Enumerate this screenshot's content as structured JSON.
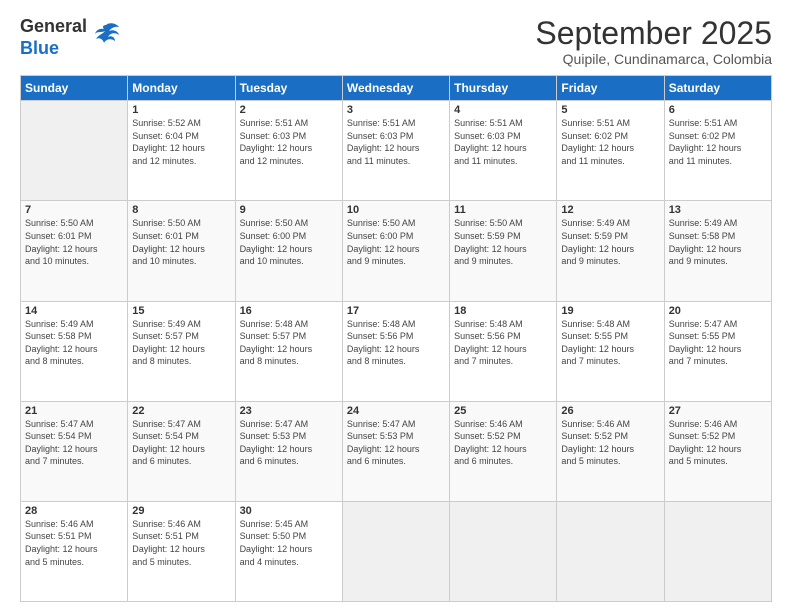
{
  "logo": {
    "general": "General",
    "blue": "Blue",
    "tagline": "GeneralBlue"
  },
  "header": {
    "month_year": "September 2025",
    "location": "Quipile, Cundinamarca, Colombia"
  },
  "weekdays": [
    "Sunday",
    "Monday",
    "Tuesday",
    "Wednesday",
    "Thursday",
    "Friday",
    "Saturday"
  ],
  "weeks": [
    [
      {
        "day": "",
        "sunrise": "",
        "sunset": "",
        "daylight": ""
      },
      {
        "day": "1",
        "sunrise": "Sunrise: 5:52 AM",
        "sunset": "Sunset: 6:04 PM",
        "daylight": "Daylight: 12 hours and 12 minutes."
      },
      {
        "day": "2",
        "sunrise": "Sunrise: 5:51 AM",
        "sunset": "Sunset: 6:03 PM",
        "daylight": "Daylight: 12 hours and 12 minutes."
      },
      {
        "day": "3",
        "sunrise": "Sunrise: 5:51 AM",
        "sunset": "Sunset: 6:03 PM",
        "daylight": "Daylight: 12 hours and 11 minutes."
      },
      {
        "day": "4",
        "sunrise": "Sunrise: 5:51 AM",
        "sunset": "Sunset: 6:03 PM",
        "daylight": "Daylight: 12 hours and 11 minutes."
      },
      {
        "day": "5",
        "sunrise": "Sunrise: 5:51 AM",
        "sunset": "Sunset: 6:02 PM",
        "daylight": "Daylight: 12 hours and 11 minutes."
      },
      {
        "day": "6",
        "sunrise": "Sunrise: 5:51 AM",
        "sunset": "Sunset: 6:02 PM",
        "daylight": "Daylight: 12 hours and 11 minutes."
      }
    ],
    [
      {
        "day": "7",
        "sunrise": "Sunrise: 5:50 AM",
        "sunset": "Sunset: 6:01 PM",
        "daylight": "Daylight: 12 hours and 10 minutes."
      },
      {
        "day": "8",
        "sunrise": "Sunrise: 5:50 AM",
        "sunset": "Sunset: 6:01 PM",
        "daylight": "Daylight: 12 hours and 10 minutes."
      },
      {
        "day": "9",
        "sunrise": "Sunrise: 5:50 AM",
        "sunset": "Sunset: 6:00 PM",
        "daylight": "Daylight: 12 hours and 10 minutes."
      },
      {
        "day": "10",
        "sunrise": "Sunrise: 5:50 AM",
        "sunset": "Sunset: 6:00 PM",
        "daylight": "Daylight: 12 hours and 9 minutes."
      },
      {
        "day": "11",
        "sunrise": "Sunrise: 5:50 AM",
        "sunset": "Sunset: 5:59 PM",
        "daylight": "Daylight: 12 hours and 9 minutes."
      },
      {
        "day": "12",
        "sunrise": "Sunrise: 5:49 AM",
        "sunset": "Sunset: 5:59 PM",
        "daylight": "Daylight: 12 hours and 9 minutes."
      },
      {
        "day": "13",
        "sunrise": "Sunrise: 5:49 AM",
        "sunset": "Sunset: 5:58 PM",
        "daylight": "Daylight: 12 hours and 9 minutes."
      }
    ],
    [
      {
        "day": "14",
        "sunrise": "Sunrise: 5:49 AM",
        "sunset": "Sunset: 5:58 PM",
        "daylight": "Daylight: 12 hours and 8 minutes."
      },
      {
        "day": "15",
        "sunrise": "Sunrise: 5:49 AM",
        "sunset": "Sunset: 5:57 PM",
        "daylight": "Daylight: 12 hours and 8 minutes."
      },
      {
        "day": "16",
        "sunrise": "Sunrise: 5:48 AM",
        "sunset": "Sunset: 5:57 PM",
        "daylight": "Daylight: 12 hours and 8 minutes."
      },
      {
        "day": "17",
        "sunrise": "Sunrise: 5:48 AM",
        "sunset": "Sunset: 5:56 PM",
        "daylight": "Daylight: 12 hours and 8 minutes."
      },
      {
        "day": "18",
        "sunrise": "Sunrise: 5:48 AM",
        "sunset": "Sunset: 5:56 PM",
        "daylight": "Daylight: 12 hours and 7 minutes."
      },
      {
        "day": "19",
        "sunrise": "Sunrise: 5:48 AM",
        "sunset": "Sunset: 5:55 PM",
        "daylight": "Daylight: 12 hours and 7 minutes."
      },
      {
        "day": "20",
        "sunrise": "Sunrise: 5:47 AM",
        "sunset": "Sunset: 5:55 PM",
        "daylight": "Daylight: 12 hours and 7 minutes."
      }
    ],
    [
      {
        "day": "21",
        "sunrise": "Sunrise: 5:47 AM",
        "sunset": "Sunset: 5:54 PM",
        "daylight": "Daylight: 12 hours and 7 minutes."
      },
      {
        "day": "22",
        "sunrise": "Sunrise: 5:47 AM",
        "sunset": "Sunset: 5:54 PM",
        "daylight": "Daylight: 12 hours and 6 minutes."
      },
      {
        "day": "23",
        "sunrise": "Sunrise: 5:47 AM",
        "sunset": "Sunset: 5:53 PM",
        "daylight": "Daylight: 12 hours and 6 minutes."
      },
      {
        "day": "24",
        "sunrise": "Sunrise: 5:47 AM",
        "sunset": "Sunset: 5:53 PM",
        "daylight": "Daylight: 12 hours and 6 minutes."
      },
      {
        "day": "25",
        "sunrise": "Sunrise: 5:46 AM",
        "sunset": "Sunset: 5:52 PM",
        "daylight": "Daylight: 12 hours and 6 minutes."
      },
      {
        "day": "26",
        "sunrise": "Sunrise: 5:46 AM",
        "sunset": "Sunset: 5:52 PM",
        "daylight": "Daylight: 12 hours and 5 minutes."
      },
      {
        "day": "27",
        "sunrise": "Sunrise: 5:46 AM",
        "sunset": "Sunset: 5:52 PM",
        "daylight": "Daylight: 12 hours and 5 minutes."
      }
    ],
    [
      {
        "day": "28",
        "sunrise": "Sunrise: 5:46 AM",
        "sunset": "Sunset: 5:51 PM",
        "daylight": "Daylight: 12 hours and 5 minutes."
      },
      {
        "day": "29",
        "sunrise": "Sunrise: 5:46 AM",
        "sunset": "Sunset: 5:51 PM",
        "daylight": "Daylight: 12 hours and 5 minutes."
      },
      {
        "day": "30",
        "sunrise": "Sunrise: 5:45 AM",
        "sunset": "Sunset: 5:50 PM",
        "daylight": "Daylight: 12 hours and 4 minutes."
      },
      {
        "day": "",
        "sunrise": "",
        "sunset": "",
        "daylight": ""
      },
      {
        "day": "",
        "sunrise": "",
        "sunset": "",
        "daylight": ""
      },
      {
        "day": "",
        "sunrise": "",
        "sunset": "",
        "daylight": ""
      },
      {
        "day": "",
        "sunrise": "",
        "sunset": "",
        "daylight": ""
      }
    ]
  ]
}
